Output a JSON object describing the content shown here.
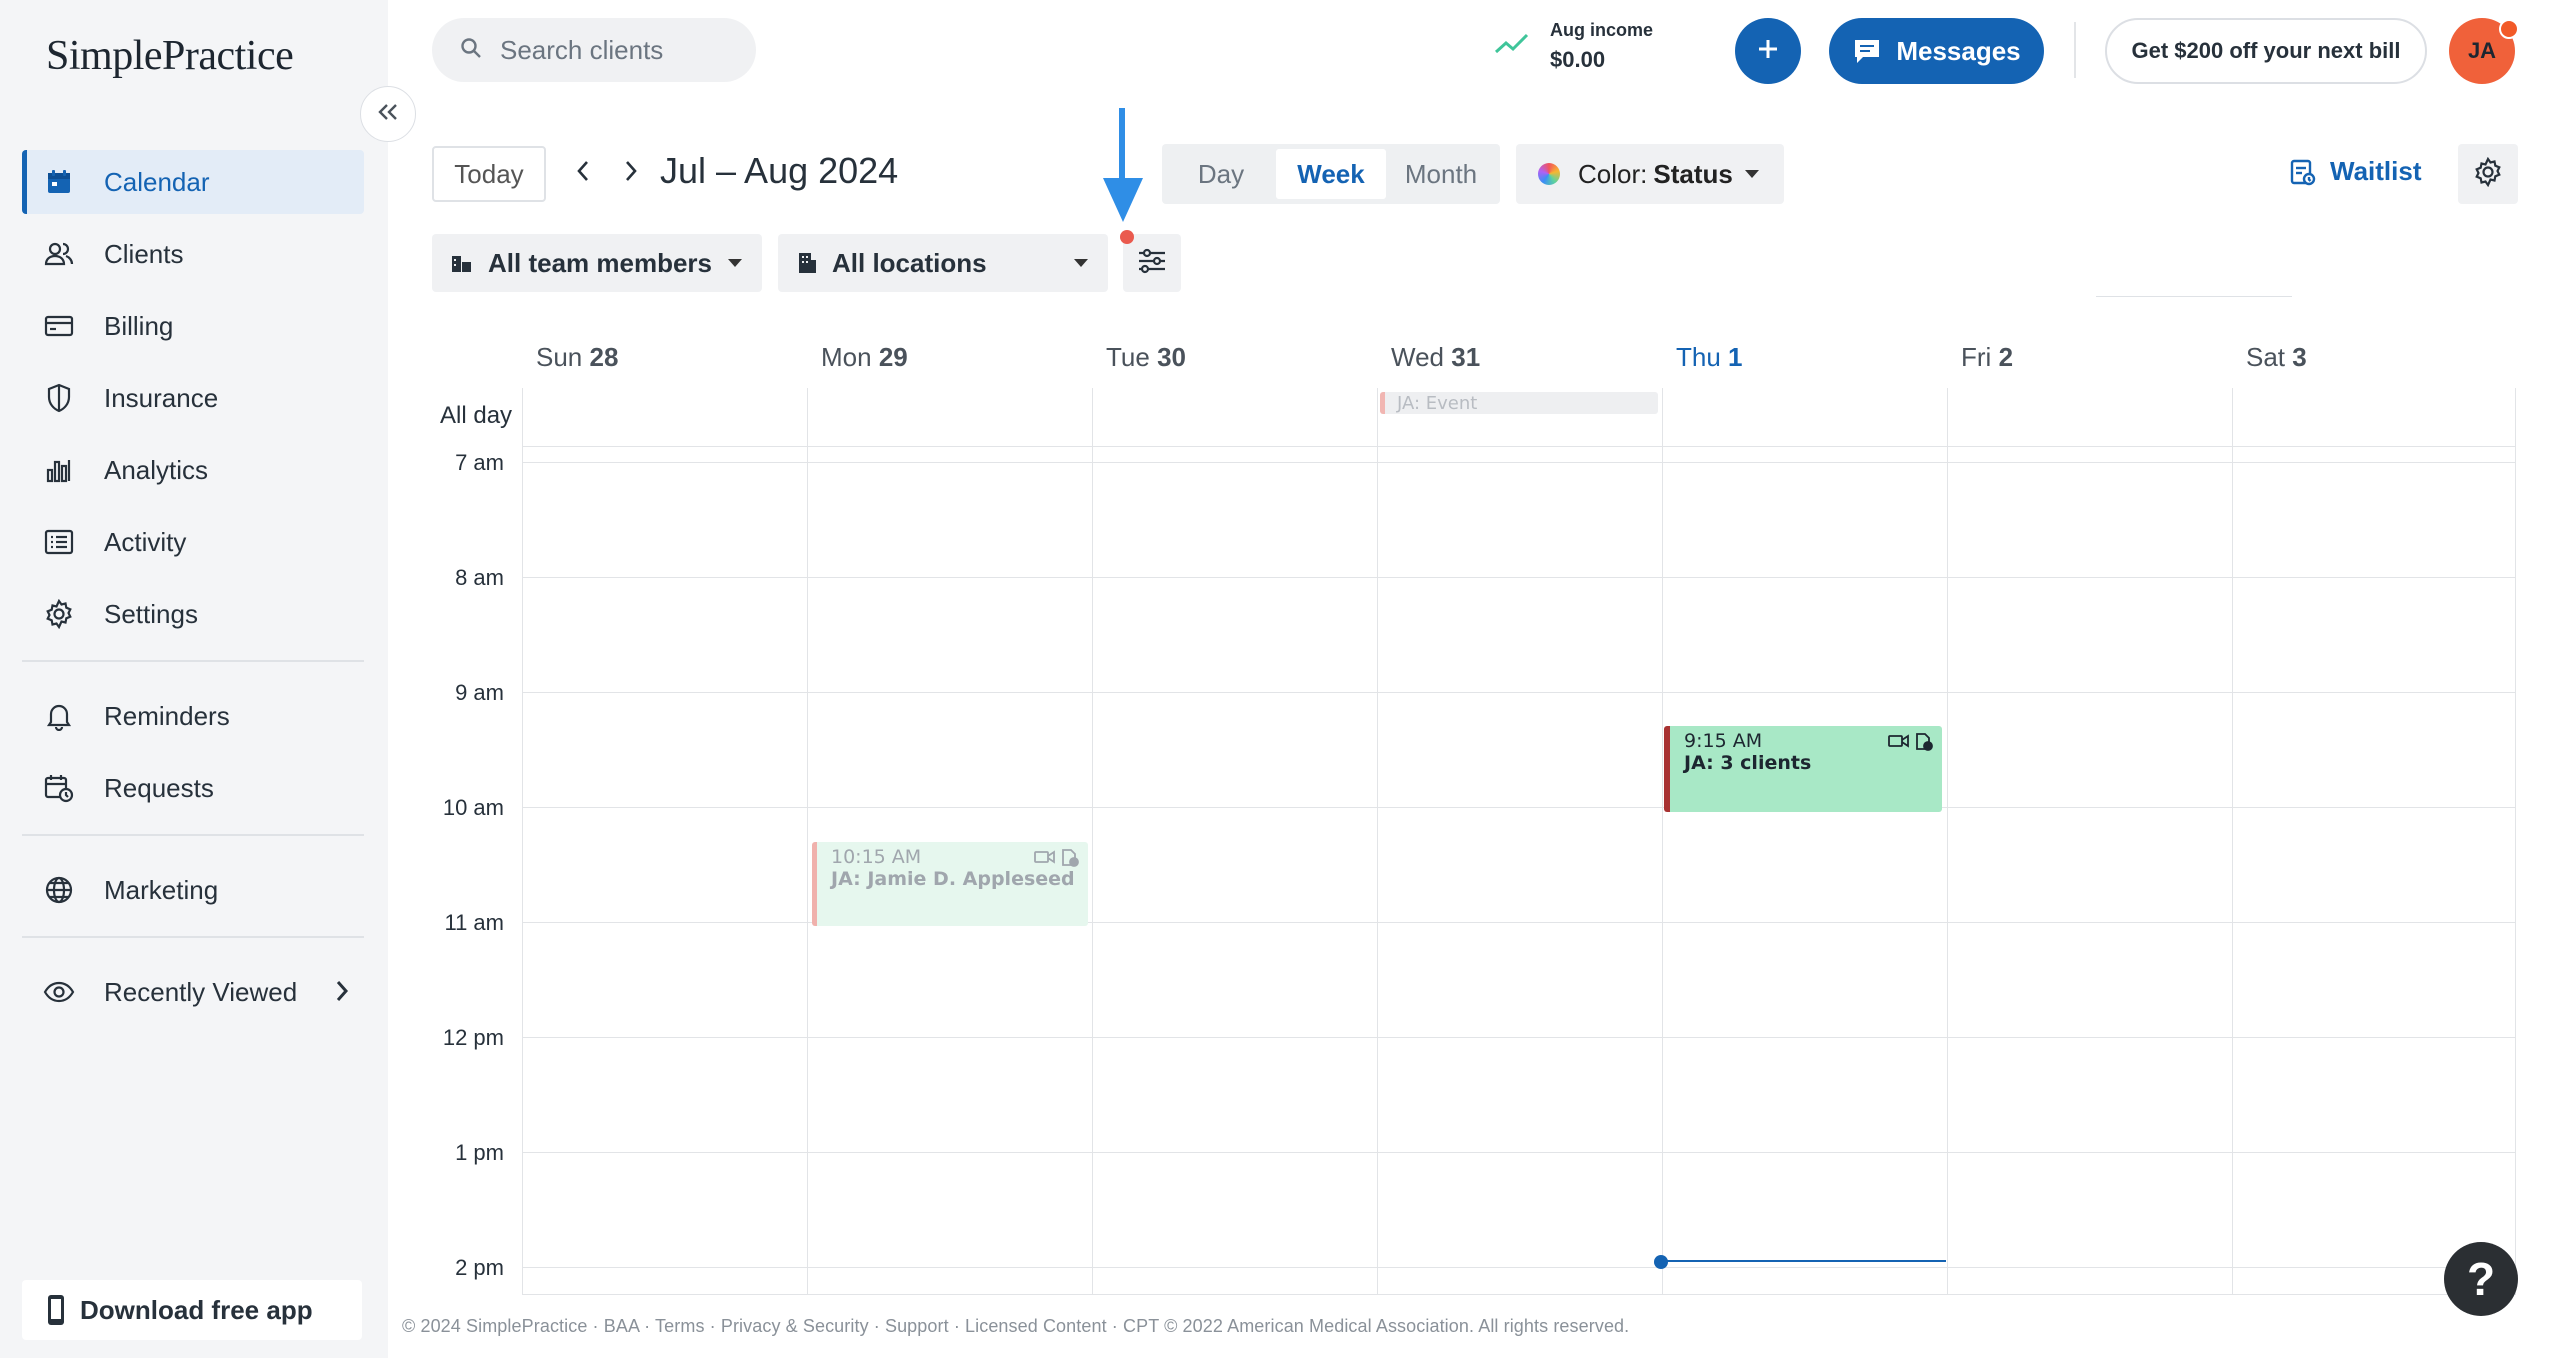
{
  "brand": {
    "logo_text": "SimplePractice"
  },
  "sidebar": {
    "items": [
      {
        "label": "Calendar",
        "icon": "calendar-icon",
        "active": true
      },
      {
        "label": "Clients",
        "icon": "clients-icon"
      },
      {
        "label": "Billing",
        "icon": "billing-card-icon"
      },
      {
        "label": "Insurance",
        "icon": "shield-icon"
      },
      {
        "label": "Analytics",
        "icon": "bar-chart-icon"
      },
      {
        "label": "Activity",
        "icon": "activity-list-icon"
      },
      {
        "label": "Settings",
        "icon": "gear-icon"
      }
    ],
    "secondary": [
      {
        "label": "Reminders",
        "icon": "bell-icon"
      },
      {
        "label": "Requests",
        "icon": "calendar-request-icon"
      }
    ],
    "marketing": {
      "label": "Marketing",
      "icon": "globe-icon"
    },
    "recently_viewed": {
      "label": "Recently Viewed",
      "icon": "eye-icon"
    },
    "download_app": "Download free app"
  },
  "topbar": {
    "search_placeholder": "Search clients",
    "income_label": "Aug income",
    "income_value": "$0.00",
    "messages_label": "Messages",
    "promo_label": "Get $200 off your next bill",
    "avatar_initials": "JA"
  },
  "toolbar": {
    "today": "Today",
    "range_title": "Jul – Aug 2024",
    "views": [
      "Day",
      "Week",
      "Month"
    ],
    "active_view": "Week",
    "color_label": "Color:",
    "color_value": "Status",
    "waitlist": "Waitlist",
    "team_filter": "All team members",
    "location_filter": "All locations"
  },
  "calendar": {
    "allday_label": "All day",
    "days": [
      {
        "name": "Sun",
        "num": "28"
      },
      {
        "name": "Mon",
        "num": "29"
      },
      {
        "name": "Tue",
        "num": "30"
      },
      {
        "name": "Wed",
        "num": "31"
      },
      {
        "name": "Thu",
        "num": "1",
        "today": true
      },
      {
        "name": "Fri",
        "num": "2"
      },
      {
        "name": "Sat",
        "num": "3"
      }
    ],
    "hours": [
      "7 am",
      "8 am",
      "9 am",
      "10 am",
      "11 am",
      "12 pm",
      "1 pm",
      "2 pm"
    ],
    "events": {
      "allday_event": "JA: Event",
      "jamie_time": "10:15 AM",
      "jamie_title": "JA: Jamie D. Appleseed",
      "group_time": "9:15 AM",
      "group_title": "JA: 3 clients"
    }
  },
  "footer": "© 2024 SimplePractice · BAA · Terms · Privacy & Security · Support · Licensed Content · CPT © 2022 American Medical Association. All rights reserved.",
  "help": "?",
  "colors": {
    "accent": "#1463b3",
    "event_green": "#a8e8c6",
    "event_border": "#a83232",
    "avatar": "#f0613a"
  }
}
